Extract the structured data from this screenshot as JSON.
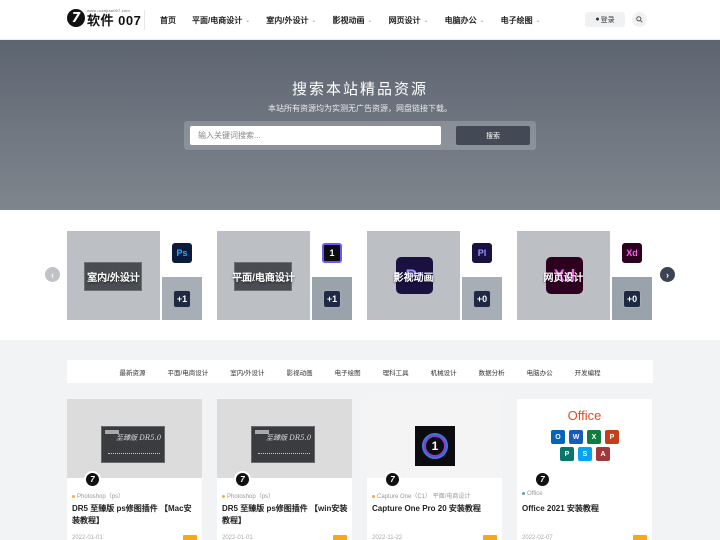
{
  "header": {
    "logo_small": "www.ruanjian007.com",
    "logo_text": "软件 007",
    "logo_mark": "7",
    "nav": [
      {
        "label": "首页",
        "dropdown": false
      },
      {
        "label": "平面/电商设计",
        "dropdown": true
      },
      {
        "label": "室内/外设计",
        "dropdown": true
      },
      {
        "label": "影视动画",
        "dropdown": true
      },
      {
        "label": "网页设计",
        "dropdown": true
      },
      {
        "label": "电脑办公",
        "dropdown": true
      },
      {
        "label": "电子绘图",
        "dropdown": true
      }
    ],
    "login_label": "登录",
    "search_icon": "search-icon"
  },
  "hero": {
    "title": "搜索本站精品资源",
    "subtitle": "本站所有资源均为实测无广告资源，网盘链接下载。",
    "search_placeholder": "输入关键词搜索...",
    "search_button": "搜索"
  },
  "categories": [
    {
      "title": "室内/外设计",
      "top_icon": "Ps",
      "top_color": "#0a1b3d",
      "top_text_color": "#31a8ff",
      "bottom_badge": "+1"
    },
    {
      "title": "平面/电商设计",
      "top_icon": "1",
      "top_color": "#0b0b10",
      "top_text_color": "#ffffff",
      "bottom_badge": "+1"
    },
    {
      "title": "影视动画",
      "top_icon": "Pl",
      "top_color": "#1a1140",
      "top_text_color": "#9999ff",
      "bottom_badge": "+0"
    },
    {
      "title": "网页设计",
      "top_icon": "Xd",
      "top_color": "#2e001f",
      "top_text_color": "#ff61f6",
      "bottom_badge": "+0"
    }
  ],
  "tabs": [
    "最新资源",
    "平面/电商设计",
    "室内/外设计",
    "影视动画",
    "电子绘图",
    "理科工具",
    "机械设计",
    "数据分析",
    "电脑办公",
    "开发编程"
  ],
  "posts": [
    {
      "category": "Photoshop（ps）",
      "title": "DR5 至臻版 ps修图插件 【Mac安装教程】",
      "date": "2022-01-01"
    },
    {
      "category": "Photoshop（ps）",
      "title": "DR5 至臻版 ps修图插件 【win安装教程】",
      "date": "2022-01-01"
    },
    {
      "category": "Capture One（C1）  平面/电商设计",
      "title": "Capture One Pro 20 安装教程",
      "date": "2022-11-22"
    },
    {
      "category": "Office",
      "title": "Office 2021 安装教程",
      "date": "2022-02-07"
    }
  ],
  "office_word": "Office",
  "dr5_logo": "至臻版 DR5.0"
}
